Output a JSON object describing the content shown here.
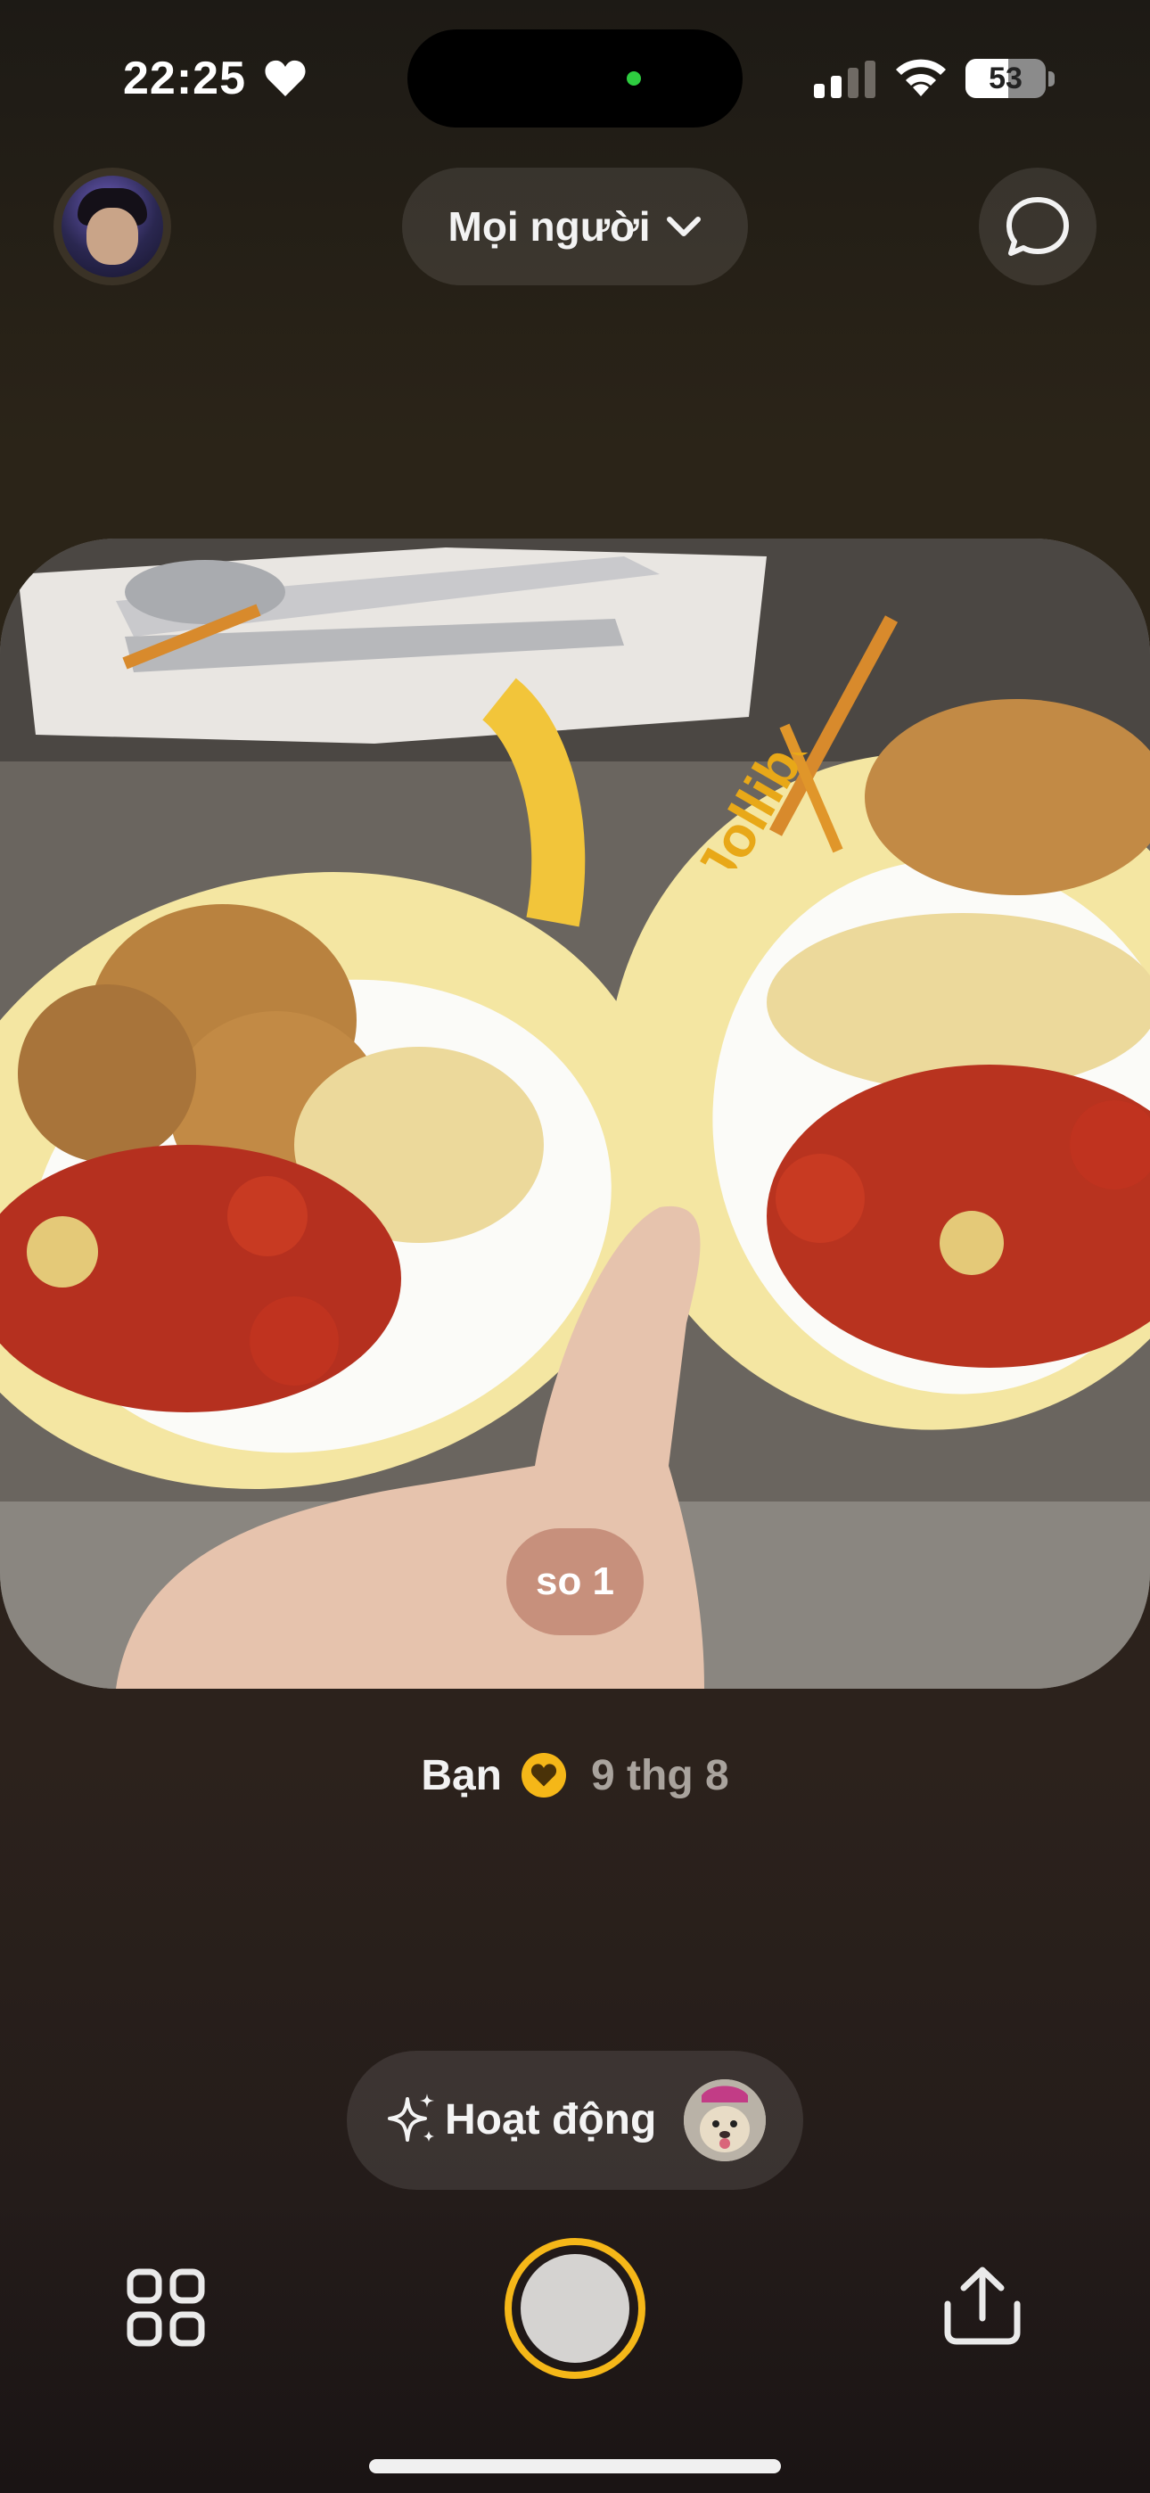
{
  "status_bar": {
    "time": "22:25",
    "battery_level": "53",
    "battery_fraction": 0.53
  },
  "header": {
    "audience_label": "Mọi người"
  },
  "post": {
    "caption": "so 1",
    "author": "Bạn",
    "date": "9 thg 8",
    "plate_brand_text": "Jollibee"
  },
  "activity": {
    "label": "Hoạt động"
  },
  "colors": {
    "accent": "#f5b718",
    "background": "#2b2418",
    "online_dot": "#2ecc40"
  },
  "icons": {
    "status_heart": "heart-icon",
    "signal": "signal-icon",
    "wifi": "wifi-icon",
    "chevron": "chevron-down-icon",
    "chat": "chat-bubble-icon",
    "badge": "gold-heart-icon",
    "sparkle": "sparkle-icon",
    "grid": "grid-icon",
    "share": "share-icon"
  }
}
